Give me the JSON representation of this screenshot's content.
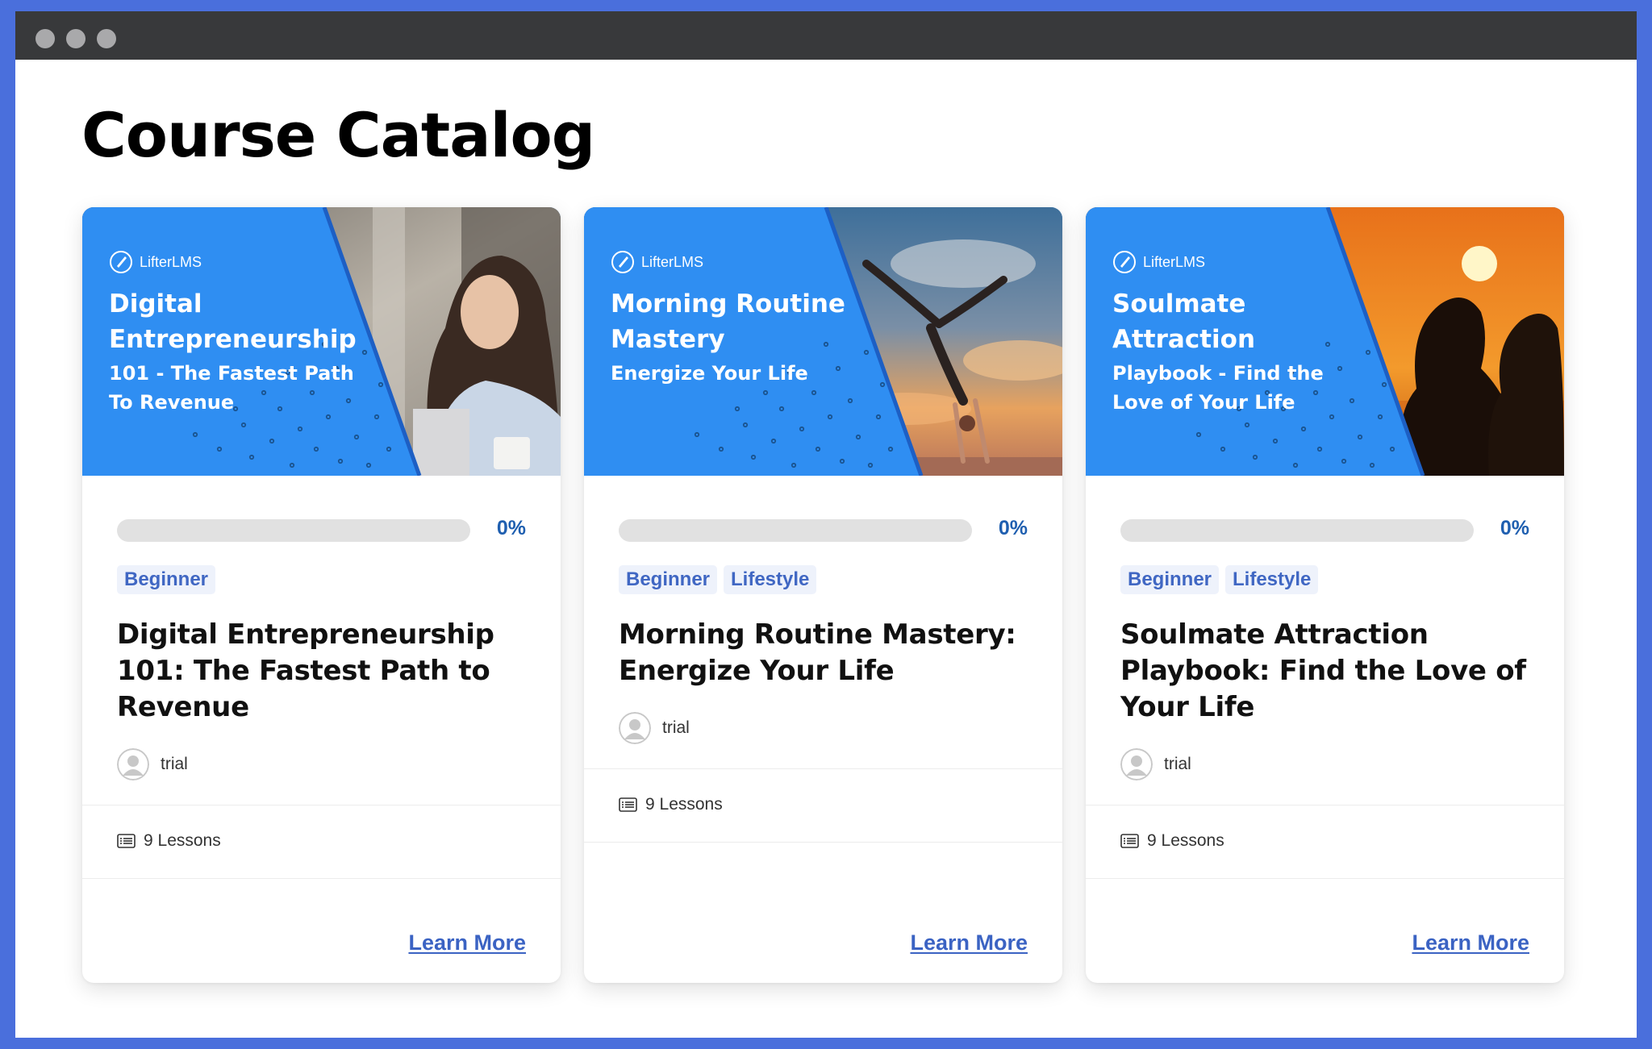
{
  "page": {
    "title": "Course Catalog"
  },
  "colors": {
    "frame": "#4a6fdc",
    "banner_blue": "#2f8ef2",
    "tag_text": "#4067c3",
    "link": "#3b63c3",
    "percent": "#1f5fb0"
  },
  "courses": [
    {
      "banner": {
        "brand": "LifterLMS",
        "title": "Digital Entrepreneurship",
        "subtitle": "101 - The Fastest Path To Revenue"
      },
      "progress": 0,
      "progress_label": "0%",
      "tags": [
        "Beginner"
      ],
      "title": "Digital Entrepreneurship 101: The Fastest Path to Revenue",
      "author": "trial",
      "lessons": "9 Lessons",
      "cta": "Learn More"
    },
    {
      "banner": {
        "brand": "LifterLMS",
        "title": "Morning Routine Mastery",
        "subtitle": "Energize Your Life"
      },
      "progress": 0,
      "progress_label": "0%",
      "tags": [
        "Beginner",
        "Lifestyle"
      ],
      "title": "Morning Routine Mastery: Energize Your Life",
      "author": "trial",
      "lessons": "9 Lessons",
      "cta": "Learn More"
    },
    {
      "banner": {
        "brand": "LifterLMS",
        "title": "Soulmate Attraction",
        "subtitle": "Playbook - Find the Love of Your Life"
      },
      "progress": 0,
      "progress_label": "0%",
      "tags": [
        "Beginner",
        "Lifestyle"
      ],
      "title": "Soulmate Attraction Playbook: Find the Love of Your Life",
      "author": "trial",
      "lessons": "9 Lessons",
      "cta": "Learn More"
    }
  ]
}
